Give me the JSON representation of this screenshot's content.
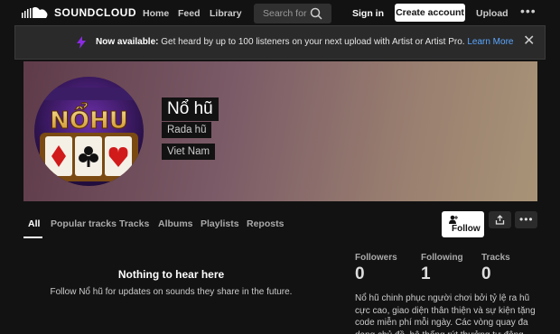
{
  "nav": {
    "logo_text": "SOUNDCLOUD",
    "links": [
      "Home",
      "Feed",
      "Library"
    ],
    "search_placeholder": "Search for a",
    "signin": "Sign in",
    "create_account": "Create account",
    "upload": "Upload",
    "more": "•••"
  },
  "banner": {
    "bold": "Now available:",
    "text": " Get heard by up to 100 listeners on your next upload with Artist or Artist Pro. ",
    "link": "Learn More",
    "close": "✕"
  },
  "hero": {
    "name": "Nổ hũ",
    "subtitle": "Rada hũ",
    "location": "Viet Nam",
    "avatar_text": "NỔHU"
  },
  "tabs": [
    "All",
    "Popular tracks",
    "Tracks",
    "Albums",
    "Playlists",
    "Reposts"
  ],
  "actions": {
    "follow": "Follow",
    "more": "•••"
  },
  "empty": {
    "title": "Nothing to hear here",
    "subtitle": "Follow Nổ hũ for updates on sounds they share in the future."
  },
  "stats": [
    {
      "label": "Followers",
      "value": "0"
    },
    {
      "label": "Following",
      "value": "1"
    },
    {
      "label": "Tracks",
      "value": "0"
    }
  ],
  "description": "Nổ hũ chinh phục người chơi bởi tỷ lệ ra hũ cực cao, giao diện thân thiện và sự kiện tặng code miễn phí mỗi ngày. Các vòng quay đa dạng chủ đề, hệ thống rút thưởng tự động nhanh gọn, bổ",
  "colors": {
    "accent_link": "#5aa6ff",
    "background": "#121212",
    "banner_icon": "#8a2be2"
  }
}
